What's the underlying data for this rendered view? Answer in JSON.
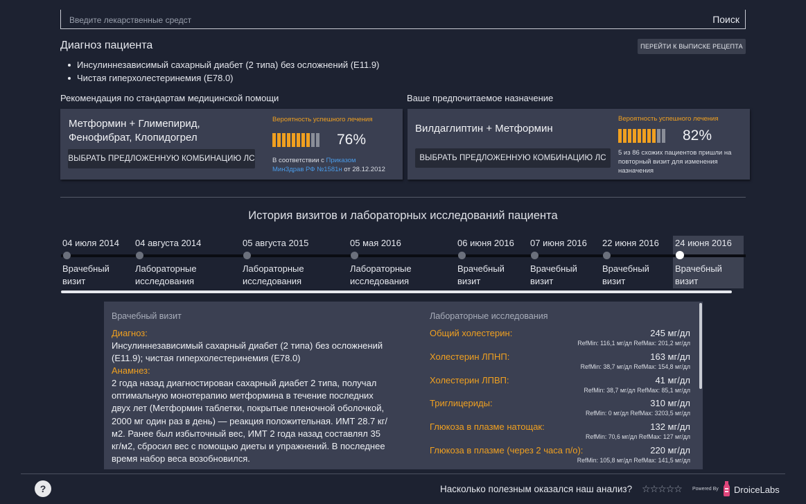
{
  "search": {
    "placeholder": "Введите лекарственные средст",
    "button": "Поиск"
  },
  "diagnosis": {
    "title": "Диагноз пациента",
    "goto_button": "ПЕРЕЙТИ К ВЫПИСКЕ РЕЦЕПТА",
    "items": [
      "Инсулиннезависимый сахарный диабет (2 типа) без осложнений (E11.9)",
      "Чистая гиперхолестеринемия (E78.0)"
    ]
  },
  "recommendation": {
    "title": "Рекомендация по стандартам медицинской помощи",
    "drug_line1": "Метформин + Глимепирид,",
    "drug_line2": "Фенофибрат, Клопидогрел",
    "button": "ВЫБРАТЬ ПРЕДЛОЖЕННУЮ КОМБИНАЦИЮ ЛС",
    "prob_label": "Вероятность успешного лечения",
    "prob_value": "76%",
    "prob_fraction": 0.76,
    "note_prefix": "В соответствии с ",
    "note_link1": "Приказом",
    "note_link2": "МинЗдрав РФ №1581н",
    "note_suffix": " от 28.12.2012"
  },
  "preferred": {
    "title": "Ваше предпочитаемое назначение",
    "drug": "Вилдаглиптин + Метформин",
    "button": "ВЫБРАТЬ ПРЕДЛОЖЕННУЮ КОМБИНАЦИЮ ЛС",
    "prob_label": "Вероятность успешного лечения",
    "prob_value": "82%",
    "prob_fraction": 0.82,
    "note_line1": "5 из 86 схожих пациентов пришли на",
    "note_line2": "повторный визит для изменения",
    "note_line3": "назначения"
  },
  "history": {
    "title": "История визитов и лабораторных исследований пациента",
    "visits": [
      {
        "date": "04 июля 2014",
        "type1": "Врачебный",
        "type2": "визит"
      },
      {
        "date": "04 августа 2014",
        "type1": "Лабораторные",
        "type2": "исследования"
      },
      {
        "date": "05 августа 2015",
        "type1": "Лабораторные",
        "type2": "исследования"
      },
      {
        "date": "05 мая 2016",
        "type1": "Лабораторные",
        "type2": "исследования"
      },
      {
        "date": "06 июня 2016",
        "type1": "Врачебный",
        "type2": "визит"
      },
      {
        "date": "07 июня 2016",
        "type1": "Врачебный",
        "type2": "визит"
      },
      {
        "date": "22 июня 2016",
        "type1": "Врачебный",
        "type2": "визит"
      },
      {
        "date": "24 июня 2016",
        "type1": "Врачебный",
        "type2": "визит"
      }
    ]
  },
  "detail": {
    "visit_head": "Врачебный визит",
    "diag_label": "Диагноз:",
    "diag_text1": "Инсулиннезависимый сахарный диабет (2 типа) без осложнений",
    "diag_text2": "(E11.9); чистая гиперхолестеринемия (E78.0)",
    "anam_label": "Анамнез:",
    "anam_lines": [
      "2 года назад диагностирован сахарный диабет 2 типа, получал",
      "оптимальную монотерапию метформина в течение последних",
      "двух лет (Метформин таблетки, покрытые пленочной оболочкой,",
      "2000 мг один раз в день) — реакция положительная. ИМТ 28.7 кг/",
      "м2. Ранее был избыточный вес, ИМТ 2 года назад составлял 35",
      "кг/м2, сбросил вес с помощью диеты и упражнений. В последнее",
      "время набор веса возобновился."
    ],
    "lab_head": "Лабораторные исследования",
    "labs": [
      {
        "name": "Общий холестерин:",
        "value": "245 мг/дл",
        "ref": "RefMin: 116,1 мг/дл   RefMax: 201,2 мг/дл"
      },
      {
        "name": "Холестерин ЛПНП:",
        "value": "163 мг/дл",
        "ref": "RefMin: 38,7 мг/дл   RefMax: 154,8 мг/дл"
      },
      {
        "name": "Холестерин ЛПВП:",
        "value": "41 мг/дл",
        "ref": "RefMin: 38,7 мг/дл   RefMax: 85,1 мг/дл"
      },
      {
        "name": "Триглицериды:",
        "value": "310 мг/дл",
        "ref": "RefMin: 0 мг/дл   RefMax: 3203,5 мг/дл"
      },
      {
        "name": "Глюкоза в плазме натощак:",
        "value": "132 мг/дл",
        "ref": "RefMin: 70,6 мг/дл   RefMax: 127 мг/дл"
      },
      {
        "name": "Глюкоза в плазме (через 2 часа п/о):",
        "value": "220 мг/дл",
        "ref": "RefMin: 105,8 мг/дл   RefMax: 141,5 мг/дл"
      }
    ]
  },
  "footer": {
    "help": "?",
    "question": "Насколько полезным оказался наш анализ?",
    "stars": [
      "☆",
      "☆",
      "☆",
      "☆",
      "☆"
    ],
    "powered": "Powered By",
    "brand": "DroiceLabs"
  },
  "colors": {
    "background": "#1d2231",
    "card": "#3a3f51",
    "accent_orange": "#f0a020",
    "link_blue": "#4a9be8",
    "bar_empty": "#8a8e98"
  }
}
